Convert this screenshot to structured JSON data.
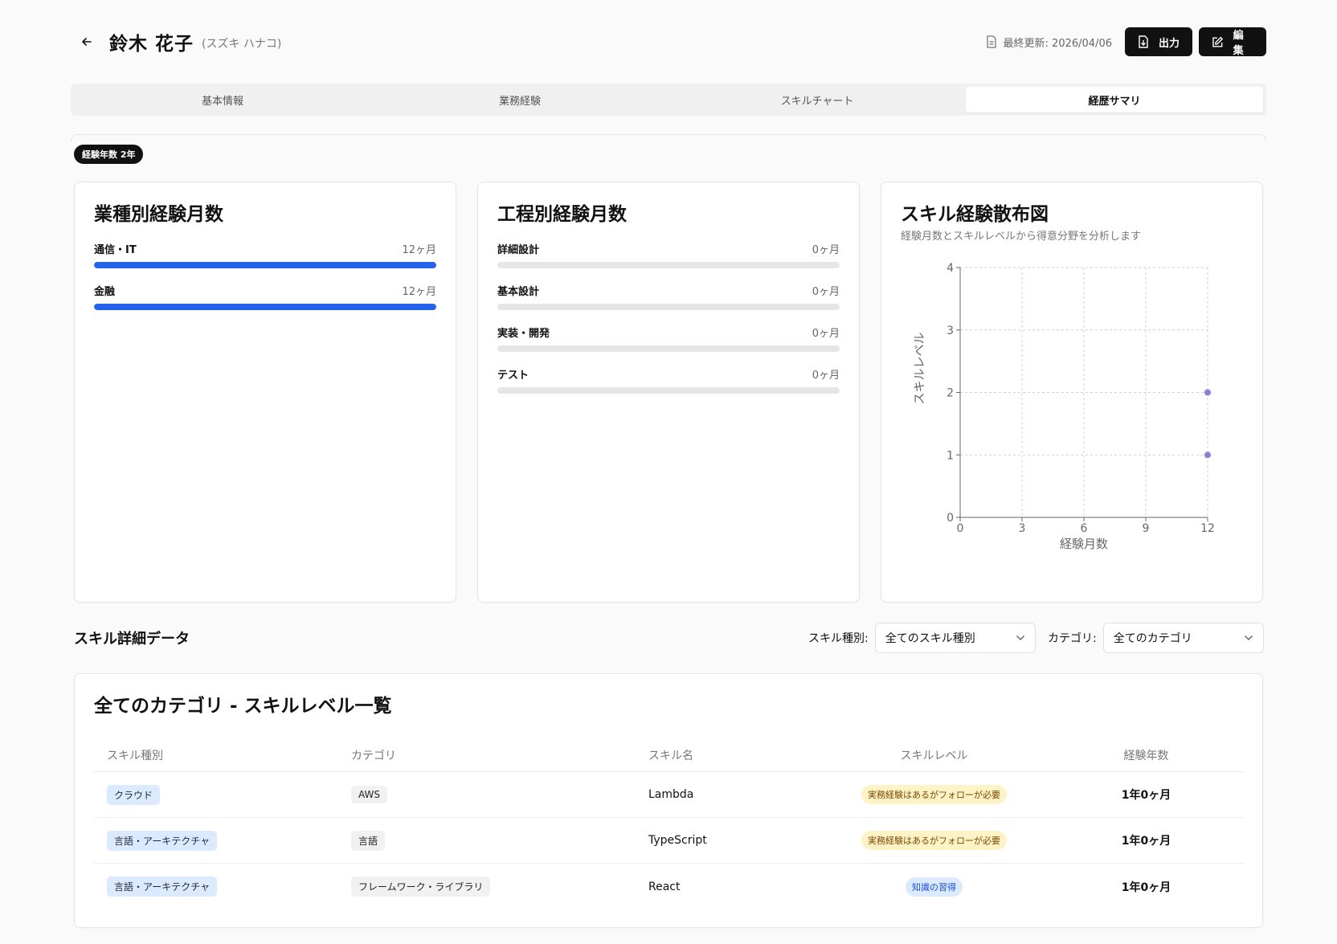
{
  "header": {
    "name": "鈴木 花子",
    "kana": "(スズキ ハナコ)",
    "updated": "最終更新: 2026/04/06",
    "export_label": "出力",
    "edit_label": "編集"
  },
  "tabs": [
    {
      "label": "基本情報",
      "active": false
    },
    {
      "label": "業務経験",
      "active": false
    },
    {
      "label": "スキルチャート",
      "active": false
    },
    {
      "label": "経歴サマリ",
      "active": true
    }
  ],
  "experience_badge": "経験年数 2年",
  "industry_card": {
    "title": "業種別経験月数",
    "items": [
      {
        "label": "通信・IT",
        "value": "12ヶ月",
        "fill": 1.0
      },
      {
        "label": "金融",
        "value": "12ヶ月",
        "fill": 1.0
      }
    ]
  },
  "process_card": {
    "title": "工程別経験月数",
    "items": [
      {
        "label": "詳細設計",
        "value": "0ヶ月",
        "fill": 0
      },
      {
        "label": "基本設計",
        "value": "0ヶ月",
        "fill": 0
      },
      {
        "label": "実装・開発",
        "value": "0ヶ月",
        "fill": 0
      },
      {
        "label": "テスト",
        "value": "0ヶ月",
        "fill": 0
      }
    ]
  },
  "scatter_card": {
    "title": "スキル経験散布図",
    "subtitle": "経験月数とスキルレベルから得意分野を分析します"
  },
  "chart_data": {
    "type": "scatter",
    "xlabel": "経験月数",
    "ylabel": "スキルレベル",
    "xlim": [
      0,
      12
    ],
    "ylim": [
      0,
      4
    ],
    "xticks": [
      0,
      3,
      6,
      9,
      12
    ],
    "yticks": [
      0,
      1,
      2,
      3,
      4
    ],
    "grid": true,
    "points": [
      {
        "x": 12,
        "y": 2
      },
      {
        "x": 12,
        "y": 1
      }
    ],
    "point_color": "#8b7fd6"
  },
  "details": {
    "title": "スキル詳細データ",
    "filter_type_label": "スキル種別:",
    "filter_type_value": "全てのスキル種別",
    "filter_cat_label": "カテゴリ:",
    "filter_cat_value": "全てのカテゴリ"
  },
  "table": {
    "title": "全てのカテゴリ - スキルレベル一覧",
    "headers": [
      "スキル種別",
      "カテゴリ",
      "スキル名",
      "スキルレベル",
      "経験年数"
    ],
    "rows": [
      {
        "type": "クラウド",
        "category": "AWS",
        "skill": "Lambda",
        "level": "実務経験はあるがフォローが必要",
        "level_style": "yellow",
        "years": "1年0ヶ月"
      },
      {
        "type": "言語・アーキテクチャ",
        "category": "言語",
        "skill": "TypeScript",
        "level": "実務経験はあるがフォローが必要",
        "level_style": "yellow",
        "years": "1年0ヶ月"
      },
      {
        "type": "言語・アーキテクチャ",
        "category": "フレームワーク・ライブラリ",
        "skill": "React",
        "level": "知識の習得",
        "level_style": "blue",
        "years": "1年0ヶ月"
      }
    ]
  },
  "colors": {
    "accent": "#2563eb",
    "dark_button": "#111111",
    "scatter_point": "#8b7fd6"
  }
}
